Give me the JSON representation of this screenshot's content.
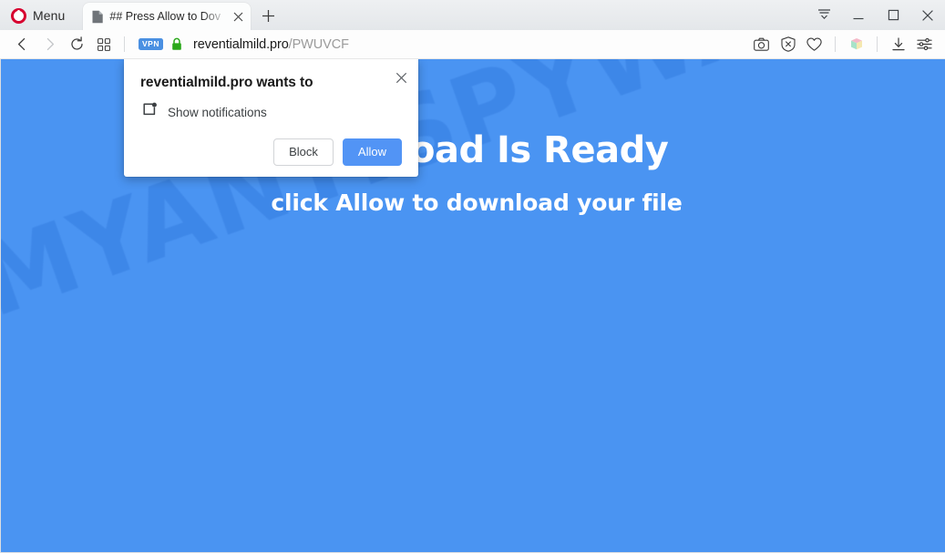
{
  "browser": {
    "name": "Opera",
    "menu_label": "Menu",
    "logo_color": "#d7002f",
    "tab": {
      "title": "## Press Allow to Dov",
      "favicon": "document-icon",
      "close": "close-icon"
    },
    "new_tab_label": "+",
    "window_controls": [
      {
        "name": "tab-menu-button",
        "glyph": "collapse-icon"
      },
      {
        "name": "minimize-button",
        "glyph": "minimize-icon"
      },
      {
        "name": "maximize-button",
        "glyph": "maximize-icon"
      },
      {
        "name": "close-window-button",
        "glyph": "close-icon"
      }
    ]
  },
  "addressbar": {
    "back_label": "back-icon",
    "forward_label": "forward-icon",
    "reload_label": "reload-icon",
    "tabgrid_label": "tab-grid-icon",
    "vpn_badge": "VPN",
    "vpn_badge_color": "#4a90e2",
    "lock": "secure-lock-icon",
    "lock_color": "#2aa81a",
    "url_host": "reventialmild.pro",
    "url_path": "/PWUVCF",
    "right_icons": [
      {
        "name": "snapshot-icon",
        "title": "Snapshot"
      },
      {
        "name": "ad-blocker-icon",
        "title": "Ad blocker"
      },
      {
        "name": "heart-icon",
        "title": "Add to favorites"
      },
      {
        "name": "cube-extension-icon",
        "title": "Extension"
      },
      {
        "name": "downloads-icon",
        "title": "Downloads"
      },
      {
        "name": "easy-setup-icon",
        "title": "Easy setup"
      }
    ]
  },
  "page": {
    "background_color": "#4a94f2",
    "headline": "Download Is Ready",
    "subline": "click Allow to download your file",
    "watermark": "MYANTISPYWARE.COM",
    "watermark_color": "#327adf"
  },
  "dialog": {
    "title": "reventialmild.pro wants to",
    "permission_icon": "notification-bell-icon",
    "permission_label": "Show notifications",
    "block_label": "Block",
    "allow_label": "Allow",
    "allow_color": "#5294f5",
    "close_label": "close-icon"
  }
}
